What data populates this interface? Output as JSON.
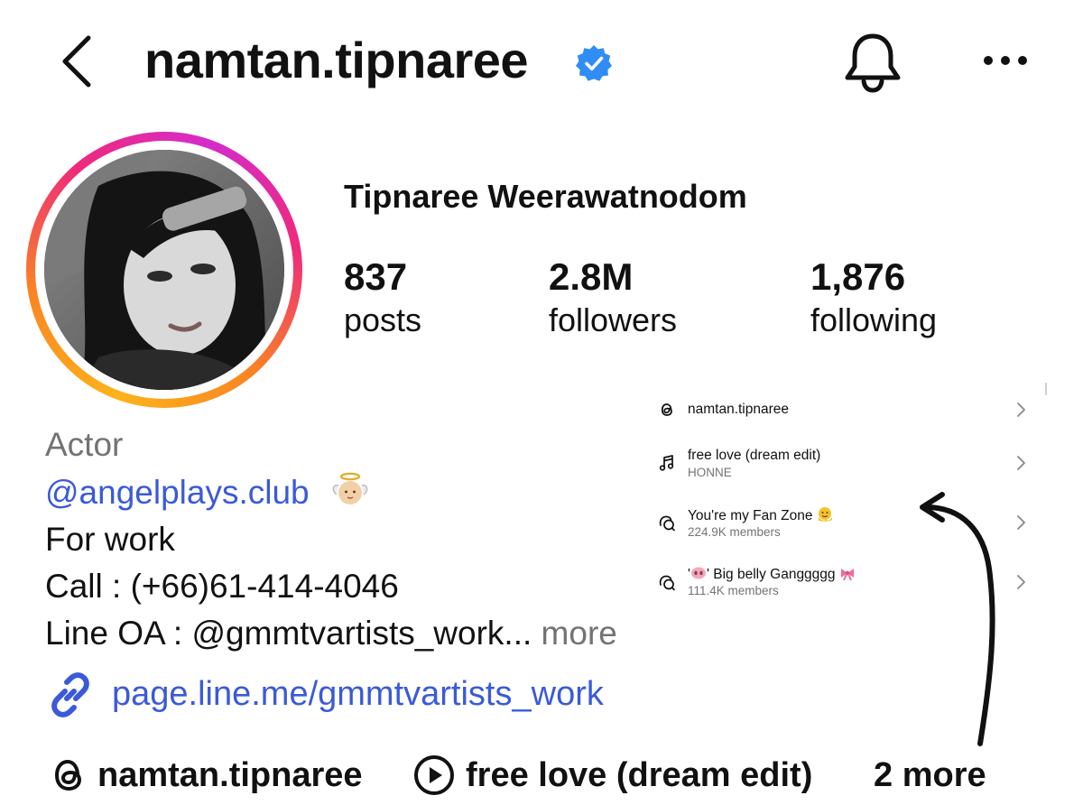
{
  "header": {
    "username": "namtan.tipnaree",
    "icons": {
      "back": "chevron-left-icon",
      "verified": "verified-badge-icon",
      "notifications": "bell-icon",
      "more": "more-horizontal-icon"
    }
  },
  "profile": {
    "full_name": "Tipnaree Weerawatnodom",
    "stats": {
      "posts": {
        "value": "837",
        "label": "posts"
      },
      "followers": {
        "value": "2.8M",
        "label": "followers"
      },
      "following": {
        "value": "1,876",
        "label": "following"
      }
    },
    "bio": {
      "category": "Actor",
      "mention": "@angelplays.club",
      "lines": [
        "For work",
        "Call : (+66)61-414-4046",
        "Line OA : @gmmtvartists_work..."
      ],
      "more_label": "more"
    },
    "link": "page.line.me/gmmtvartists_work"
  },
  "bottom_row": {
    "threads_handle": "namtan.tipnaree",
    "music": "free love (dream edit)",
    "more_count": "2 more"
  },
  "links_panel": {
    "items": [
      {
        "icon": "threads-icon",
        "title": "namtan.tipnaree",
        "subtitle": ""
      },
      {
        "icon": "music-note-icon",
        "title": "free love (dream edit)",
        "subtitle": "HONNE"
      },
      {
        "icon": "channel-icon",
        "title": "You're my Fan Zone",
        "subtitle": "224.9K members"
      },
      {
        "icon": "channel-icon",
        "title": "Big belly Ganggggg",
        "title_prefix": "'",
        "title_mid": "'",
        "subtitle": "111.4K members"
      }
    ]
  },
  "colors": {
    "link_blue": "#3a5ad9",
    "verified_blue": "#2f8df5",
    "muted_gray": "#737373",
    "story_ring": [
      "#fdb31a",
      "#f98523",
      "#ee2a7b",
      "#d52bcc"
    ]
  }
}
